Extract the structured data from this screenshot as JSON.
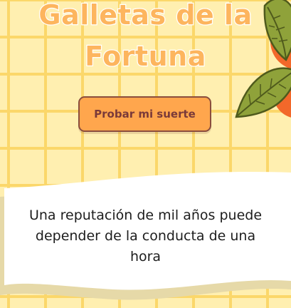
{
  "title": {
    "line1": "Galletas de la",
    "line2": "Fortuna"
  },
  "button": {
    "label": "Probar mi suerte"
  },
  "fortune": {
    "text": "Una reputación de mil años puede depender de la conducta de una hora"
  },
  "colors": {
    "background": "#ffefb0",
    "grid": "#fbd76a",
    "title_fill": "#fdb55e",
    "title_stroke": "#ffffff",
    "button_fill": "#ffa64d",
    "button_border": "#8a4d3d",
    "button_text": "#7a3a39",
    "card": "#ffffff",
    "card_shadow": "#e6d9a8",
    "leaf": "#8fa23a",
    "orange": "#f2682a"
  },
  "icons": [
    "leaf-icon",
    "orange-fruit-icon"
  ]
}
